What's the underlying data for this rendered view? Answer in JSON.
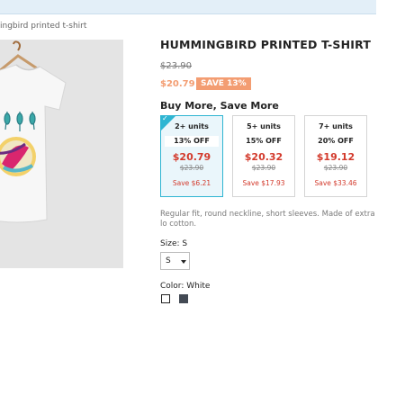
{
  "breadcrumb": {
    "current": "ingbird printed t-shirt"
  },
  "product": {
    "title": "HUMMINGBIRD PRINTED T-SHIRT",
    "old_price": "$23.90",
    "price": "$20.79",
    "discount_badge": "SAVE 13%",
    "description": "Regular fit, round neckline, short sleeves. Made of extra lo cotton.",
    "image_icon": "t-shirt-product-photo"
  },
  "bulk": {
    "heading": "Buy More, Save More",
    "tiers": [
      {
        "units": "2+ units",
        "off": "13% OFF",
        "price": "$20.79",
        "was": "$23.90",
        "save": "Save $6.21",
        "selected": true
      },
      {
        "units": "5+ units",
        "off": "15% OFF",
        "price": "$20.32",
        "was": "$23.90",
        "save": "Save $17.93",
        "selected": false
      },
      {
        "units": "7+ units",
        "off": "20% OFF",
        "price": "$19.12",
        "was": "$23.90",
        "save": "Save $33.46",
        "selected": false
      }
    ]
  },
  "size": {
    "label": "Size: S",
    "selected": "S"
  },
  "color": {
    "label": "Color: White",
    "options": [
      "White",
      "Black"
    ]
  },
  "colors": {
    "accent": "#2fb5d2",
    "discount": "#f39d72",
    "price_red": "#d33a2c"
  }
}
